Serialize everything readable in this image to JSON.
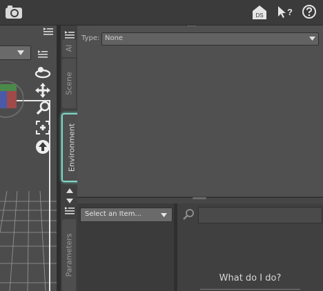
{
  "topbar": {
    "camera_icon": "camera-icon",
    "ds_icon_label": "DS",
    "help_cursor_label": "?"
  },
  "upper_panel": {
    "type_label": "Type:",
    "type_value": "None"
  },
  "tabs": [
    {
      "label": "Al"
    },
    {
      "label": "Scene"
    },
    {
      "label": "Environment"
    },
    {
      "label": "Parameters"
    }
  ],
  "lower_panel": {
    "item_select_label": "Select an Item...",
    "help_text": "What do I do?"
  },
  "colors": {
    "active_tab_highlight": "#7fd6c4",
    "panel_bg": "#505050"
  }
}
